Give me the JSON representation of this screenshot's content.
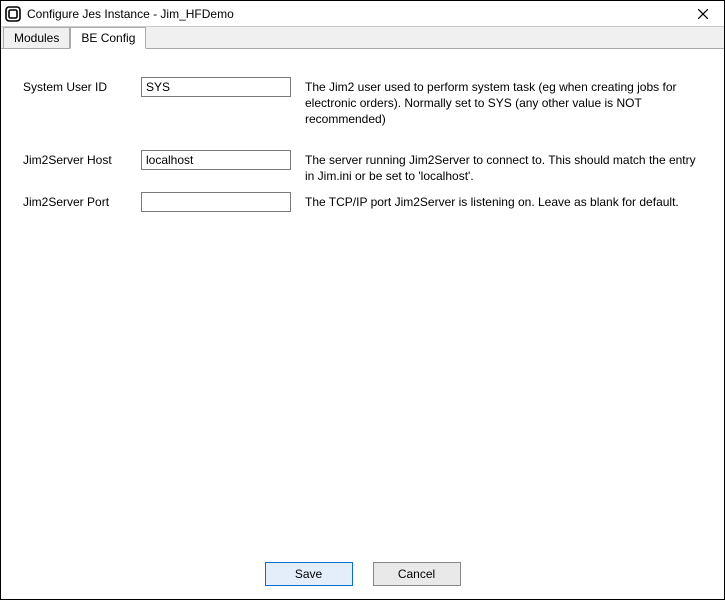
{
  "window": {
    "title": "Configure Jes Instance - Jim_HFDemo"
  },
  "tabs": {
    "modules": "Modules",
    "be_config": "BE Config"
  },
  "fields": {
    "system_user_id": {
      "label": "System User ID",
      "value": "SYS",
      "desc": "The Jim2 user used to perform system task (eg when creating jobs for electronic orders). Normally set to SYS (any other value is NOT recommended)"
    },
    "jim2server_host": {
      "label": "Jim2Server Host",
      "value": "localhost",
      "desc": "The server running Jim2Server to connect to.  This should match the entry in Jim.ini or be set to 'localhost'."
    },
    "jim2server_port": {
      "label": "Jim2Server Port",
      "value": "",
      "desc": "The TCP/IP port Jim2Server is listening on.  Leave as blank for default."
    }
  },
  "buttons": {
    "save": "Save",
    "cancel": "Cancel"
  }
}
